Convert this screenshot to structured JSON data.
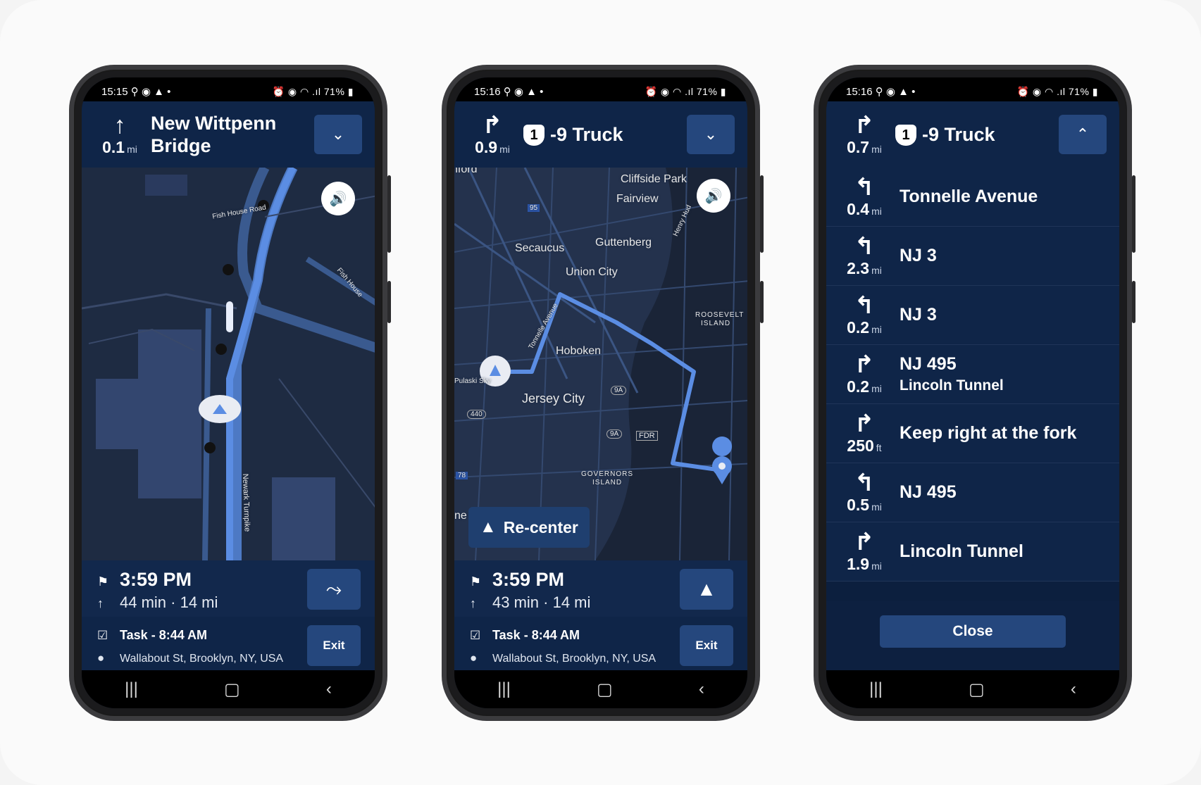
{
  "phone1": {
    "status": {
      "time": "15:15",
      "left_icons": "⚲ ◉ ▲ •",
      "right": "⏰ ◉ ◠ .ıl 71% ▮"
    },
    "header": {
      "distance": "0.1",
      "unit": "mi",
      "title_line1": "New Wittpenn",
      "title_line2": "Bridge"
    },
    "map_roads": [
      "Fish House Road",
      "Fish House",
      "Newark Turnpike"
    ],
    "eta": {
      "time": "3:59 PM",
      "duration": "44 min · 14 mi"
    },
    "task": {
      "label": "Task - 8:44 AM",
      "address": "Wallabout St, Brooklyn, NY, USA",
      "exit": "Exit"
    }
  },
  "phone2": {
    "status": {
      "time": "15:16",
      "left_icons": "⚲ ◉ ▲ •",
      "right": "⏰ ◉ ◠ .ıl 71% ▮"
    },
    "header": {
      "distance": "0.9",
      "unit": "mi",
      "shield": "1",
      "title": "-9 Truck"
    },
    "map_labels": [
      "Cliffside Park",
      "Fairview",
      "Secaucus",
      "Guttenberg",
      "Union City",
      "Hoboken",
      "Jersey City",
      "ROOSEVELT",
      "ISLAND",
      "GOVERNORS",
      "ISLAND",
      "Tonnelle Avenue",
      "Henry Hud",
      "Pulaski Sky",
      "FDR",
      "9A",
      "9A",
      "440",
      "78",
      "95",
      "nford",
      "ne"
    ],
    "recenter": "Re-center",
    "eta": {
      "time": "3:59 PM",
      "duration": "43 min · 14 mi"
    },
    "task": {
      "label": "Task - 8:44 AM",
      "address": "Wallabout St, Brooklyn, NY, USA",
      "exit": "Exit"
    }
  },
  "phone3": {
    "status": {
      "time": "15:16",
      "left_icons": "⚲ ◉ ▲ •",
      "right": "⏰ ◉ ◠ .ıl 71% ▮"
    },
    "header": {
      "distance": "0.7",
      "unit": "mi",
      "shield": "1",
      "title": "-9 Truck"
    },
    "steps": [
      {
        "distance": "0.4",
        "unit": "mi",
        "name": "Tonnelle Avenue",
        "sub": "",
        "arrow": "↰"
      },
      {
        "distance": "2.3",
        "unit": "mi",
        "name": "NJ 3",
        "sub": "",
        "arrow": "↰"
      },
      {
        "distance": "0.2",
        "unit": "mi",
        "name": "NJ 3",
        "sub": "",
        "arrow": "↰"
      },
      {
        "distance": "0.2",
        "unit": "mi",
        "name": "NJ 495",
        "sub": "Lincoln Tunnel",
        "arrow": "↱"
      },
      {
        "distance": "250",
        "unit": "ft",
        "name": "Keep right at the fork",
        "sub": "",
        "arrow": "↱"
      },
      {
        "distance": "0.5",
        "unit": "mi",
        "name": "NJ 495",
        "sub": "",
        "arrow": "↰"
      },
      {
        "distance": "1.9",
        "unit": "mi",
        "name": "Lincoln Tunnel",
        "sub": "",
        "arrow": "↱"
      }
    ],
    "close": "Close"
  }
}
